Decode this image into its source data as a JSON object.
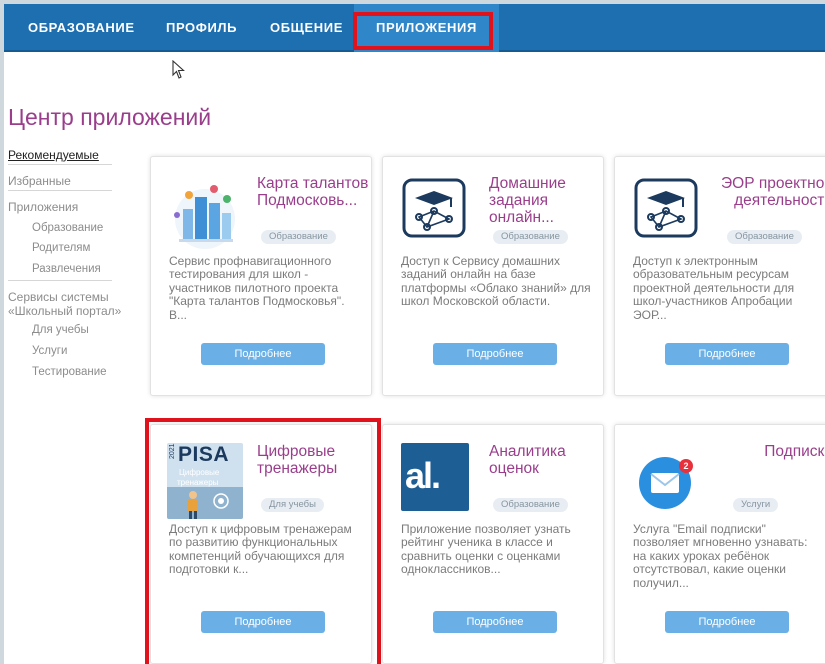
{
  "nav": {
    "education": "ОБРАЗОВАНИЕ",
    "profile": "ПРОФИЛЬ",
    "communication": "ОБЩЕНИЕ",
    "apps": "ПРИЛОЖЕНИЯ"
  },
  "page": {
    "title": "Центр приложений"
  },
  "sidebar": {
    "recommended": "Рекомендуемые",
    "favorites": "Избранные",
    "apps": "Приложения",
    "apps_education": "Образование",
    "apps_parents": "Родителям",
    "apps_entertainment": "Развлечения",
    "services_line1": "Сервисы системы",
    "services_line2": "«Школьный портал»",
    "services_study": "Для учебы",
    "services_services": "Услуги",
    "services_testing": "Тестирование"
  },
  "cards": [
    {
      "title": "Карта талантов Подмосковь...",
      "tag": "Образование",
      "desc": "Сервис профнавигационного тестирования для школ - участников пилотного проекта \"Карта талантов Подмосковья\". В...",
      "button": "Подробнее"
    },
    {
      "title": "Домашние задания онлайн...",
      "tag": "Образование",
      "desc": "Доступ к Сервису домашних заданий онлайн на базе платформы «Облако знаний» для школ Московской области.",
      "button": "Подробнее"
    },
    {
      "title": "ЭОР проектной деятельности",
      "tag": "Образование",
      "desc": "Доступ к электронным образовательным ресурсам проектной деятельности для школ-участников Апробации ЭОР...",
      "button": "Подробнее"
    },
    {
      "title": "Цифровые тренажеры",
      "tag": "Для учебы",
      "desc": "Доступ к цифровым тренажерам по развитию функциональных компетенций обучающихся для подготовки к...",
      "button": "Подробнее",
      "icon_text": {
        "year": "2021",
        "brand": "PISA",
        "line1": "Цифровые",
        "line2": "тренажеры"
      }
    },
    {
      "title": "Аналитика оценок",
      "tag": "Образование",
      "desc": "Приложение позволяет узнать рейтинг ученика в классе и сравнить оценки с оценками одноклассников...",
      "button": "Подробнее",
      "icon_text": "al."
    },
    {
      "title": "Подписки",
      "tag": "Услуги",
      "desc": "Услуга \"Email подписки\" позволяет мгновенно узнавать: на каких уроках ребёнок отсутствовал, какие оценки получил...",
      "button": "Подробнее",
      "icon_badge": "2"
    }
  ],
  "colors": {
    "topbar": "#1e6fb0",
    "accent_title": "#9a3e8c",
    "button": "#6ab0e6",
    "highlight": "#e0121b"
  }
}
